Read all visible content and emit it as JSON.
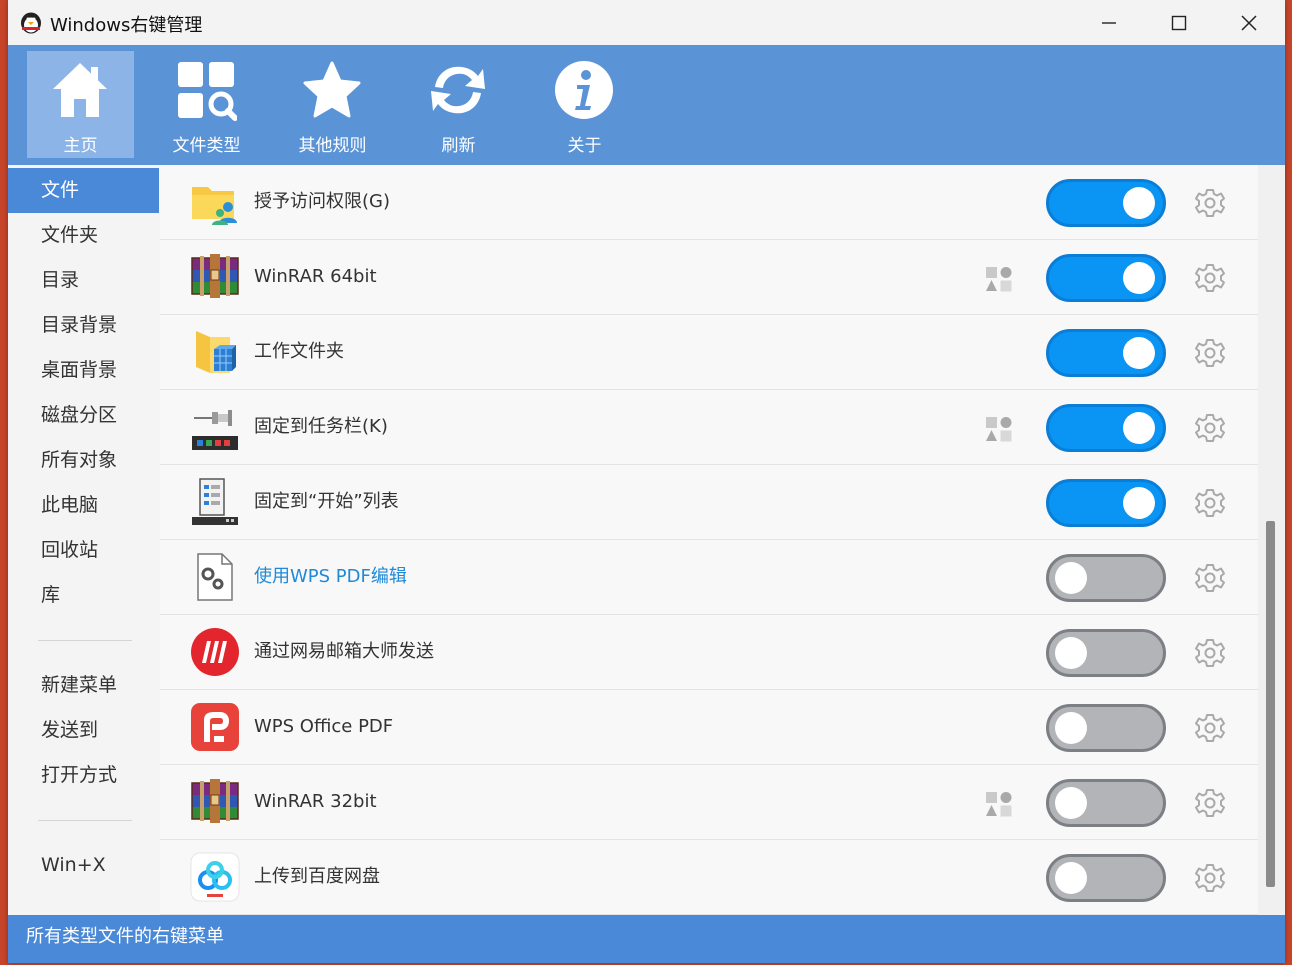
{
  "window": {
    "title": "Windows右键管理",
    "minimize_icon": "minimize-icon",
    "maximize_icon": "maximize-icon",
    "close_icon": "close-icon"
  },
  "toolbar": {
    "items": [
      {
        "label": "主页",
        "icon": "home-icon",
        "active": true
      },
      {
        "label": "文件类型",
        "icon": "grid-search-icon",
        "active": false
      },
      {
        "label": "其他规则",
        "icon": "star-icon",
        "active": false
      },
      {
        "label": "刷新",
        "icon": "refresh-icon",
        "active": false
      },
      {
        "label": "关于",
        "icon": "info-icon",
        "active": false
      }
    ]
  },
  "sidebar": {
    "items": [
      {
        "label": "文件",
        "active": true
      },
      {
        "label": "文件夹"
      },
      {
        "label": "目录"
      },
      {
        "label": "目录背景"
      },
      {
        "label": "桌面背景"
      },
      {
        "label": "磁盘分区"
      },
      {
        "label": "所有对象"
      },
      {
        "label": "此电脑"
      },
      {
        "label": "回收站"
      },
      {
        "label": "库"
      },
      {
        "label": "新建菜单"
      },
      {
        "label": "发送到"
      },
      {
        "label": "打开方式"
      },
      {
        "label": "Win+X"
      }
    ]
  },
  "list": {
    "rows": [
      {
        "label": "授予访问权限(G)",
        "icon": "share-folder-icon",
        "enabled": true,
        "shell_ext": false,
        "link": false
      },
      {
        "label": "WinRAR 64bit",
        "icon": "winrar-icon",
        "enabled": true,
        "shell_ext": true,
        "link": false
      },
      {
        "label": "工作文件夹",
        "icon": "work-folder-icon",
        "enabled": true,
        "shell_ext": false,
        "link": false
      },
      {
        "label": "固定到任务栏(K)",
        "icon": "pin-taskbar-icon",
        "enabled": true,
        "shell_ext": true,
        "link": false
      },
      {
        "label": "固定到“开始”列表",
        "icon": "pin-start-icon",
        "enabled": true,
        "shell_ext": false,
        "link": false
      },
      {
        "label": "使用WPS PDF编辑",
        "icon": "settings-file-icon",
        "enabled": false,
        "shell_ext": false,
        "link": true
      },
      {
        "label": "通过网易邮箱大师发送",
        "icon": "netease-mail-icon",
        "enabled": false,
        "shell_ext": false,
        "link": false
      },
      {
        "label": "WPS Office PDF",
        "icon": "wps-pdf-icon",
        "enabled": false,
        "shell_ext": false,
        "link": false
      },
      {
        "label": "WinRAR 32bit",
        "icon": "winrar-icon",
        "enabled": false,
        "shell_ext": true,
        "link": false
      },
      {
        "label": "上传到百度网盘",
        "icon": "baidu-netdisk-icon",
        "enabled": false,
        "shell_ext": false,
        "link": false
      }
    ]
  },
  "statusbar": {
    "text": "所有类型文件的右键菜单"
  },
  "colors": {
    "toolbar_bg": "#5a93d6",
    "accent": "#4a89d8",
    "toggle_on": "#0a94f4",
    "toggle_off": "#b2b4b8",
    "link": "#1f8ad8"
  }
}
